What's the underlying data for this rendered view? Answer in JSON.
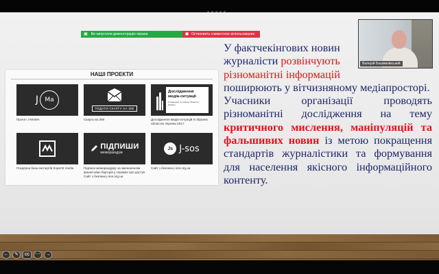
{
  "screen_share_bar": {
    "info_text": "Ви запустили демонстрацію екрана",
    "stop_text": "Остановить совместное использование"
  },
  "projects": {
    "title": "НАШІ ПРОЕКТИ",
    "items": [
      {
        "caption": "Проєкт J-MAMA",
        "logo_j": "J",
        "logo_ring": "Ma"
      },
      {
        "caption": "Скарга на ЗМІ",
        "logo_text": "ПОДАТИ СКАРГУ НА ЗМІ"
      },
      {
        "caption": "Дослідження медіа-ситуацій в обраних областях України 2017",
        "logo_title": "Дослідження медіа-ситуації",
        "logo_sub": "в південних та східних областях України"
      },
      {
        "caption": "Гендерна база експертів Expert4 media"
      },
      {
        "caption": "Підписи меморандуму за зменшенням фінансових бар'єрів у справах про доступ Сайт з безпеки j-sos.org.ua",
        "logo_word1": "ПІДПИШИ",
        "logo_word2": "меморандум"
      },
      {
        "caption": "Сайт з безпеки j-sos.org.ua",
        "logo_circle": "Js",
        "logo_word": "J-sos"
      }
    ]
  },
  "body_text": {
    "p1_a": "У фактчекінгових новин",
    "p1_b": "журналісти ",
    "p1_c_red": "розвінчують",
    "p1_d_red": "різноманітні інформацій",
    "p1_e": "поширюють у вітчизняному медіапросторі.",
    "p2_a": "Учасники організації проводять різноманітні дослідження на тему ",
    "p2_b_red": "критичного мислення, маніпуляцій та фальшивих новин",
    "p2_c": " із метою покращення стандартів журналістики та формування для населення якісного інформаційного контенту."
  },
  "video": {
    "participant_name": "Валерій Башманівський"
  },
  "controls": {
    "prev": "←",
    "pen": "✎",
    "cc": "CC",
    "more": "⋯",
    "next": "→"
  },
  "colors": {
    "body_text": "#1c2468",
    "highlight": "#e0131b",
    "share_green": "#27a844",
    "share_red": "#dc3545"
  }
}
